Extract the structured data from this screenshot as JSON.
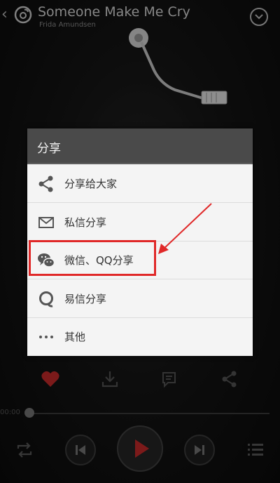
{
  "player": {
    "song_title": "Someone Make Me Cry",
    "artist": "Frida Amundsen",
    "time_elapsed": "00:00"
  },
  "share_dialog": {
    "title": "分享",
    "items": [
      {
        "label": "分享给大家",
        "icon": "share-icon"
      },
      {
        "label": "私信分享",
        "icon": "mail-icon"
      },
      {
        "label": "微信、QQ分享",
        "icon": "wechat-icon"
      },
      {
        "label": "易信分享",
        "icon": "yixin-icon"
      },
      {
        "label": "其他",
        "icon": "more-icon"
      }
    ]
  },
  "colors": {
    "accent_red": "#c82a2a",
    "highlight_red": "#e02828",
    "dialog_header": "#4a4a4a",
    "dialog_bg": "#f4f4f4"
  }
}
